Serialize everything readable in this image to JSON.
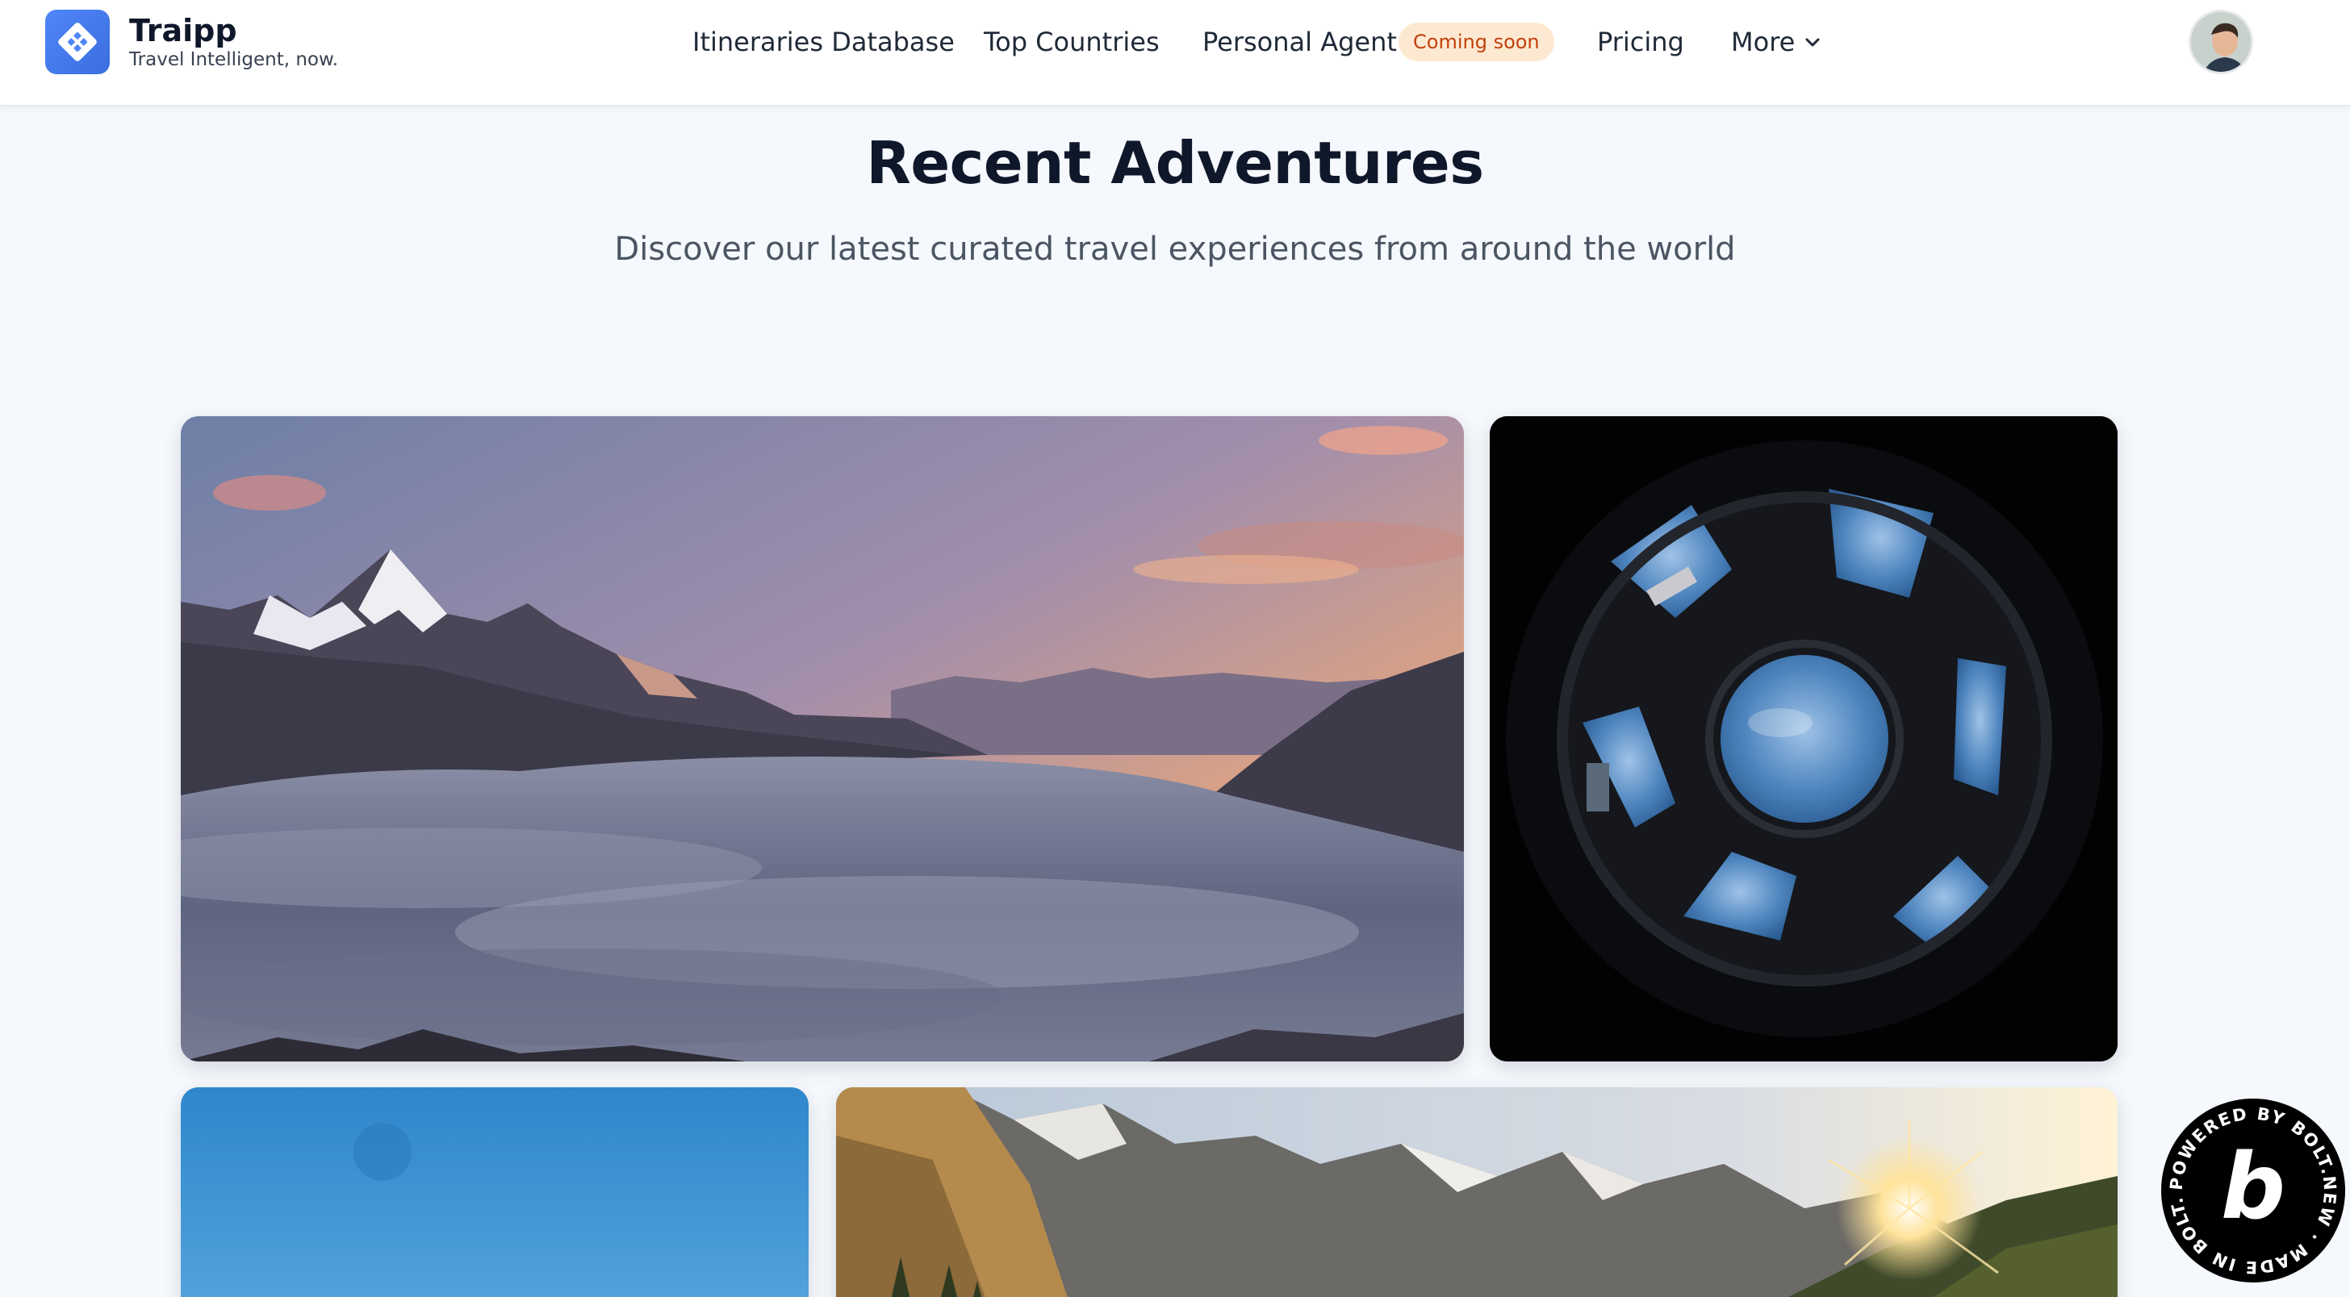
{
  "brand": {
    "name": "Traipp",
    "tagline": "Travel Intelligent, now.",
    "accent": "#4f86f7"
  },
  "nav": {
    "items": [
      {
        "label": "Itineraries Database"
      },
      {
        "label": "Top Countries"
      },
      {
        "label": "Personal Agent",
        "badge": "Coming soon"
      },
      {
        "label": "Pricing"
      },
      {
        "label": "More",
        "icon": "chevron-down-icon"
      }
    ]
  },
  "header": {
    "avatar_icon": "user-avatar"
  },
  "hero": {
    "title": "Recent Adventures",
    "subtitle": "Discover our latest curated travel experiences from around the world"
  },
  "gallery": {
    "cards": [
      {
        "subject": "mountains-above-clouds-sunset"
      },
      {
        "subject": "space-station-window-earth"
      },
      {
        "subject": "blue-sky"
      },
      {
        "subject": "sunlit-rocky-mountain-valley"
      }
    ]
  },
  "bolt_badge": {
    "text": "POWERED BY BOLT.NEW · MADE IN BOLT.NEW ·",
    "letter": "b"
  }
}
